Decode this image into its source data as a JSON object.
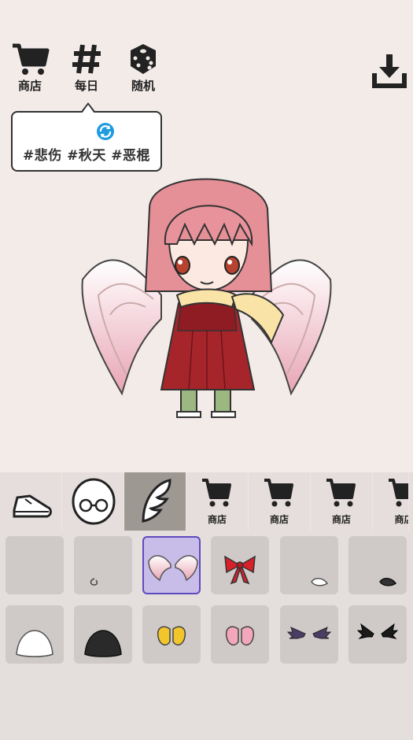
{
  "top_bar": {
    "shop_label": "商店",
    "daily_label": "每日",
    "random_label": "随机"
  },
  "daily_bubble": {
    "tags": "#悲伤 #秋天 #恶棍"
  },
  "category_bar": {
    "categories": [
      {
        "name": "shoes",
        "icon": "shoe-icon"
      },
      {
        "name": "face",
        "icon": "glasses-face-icon"
      },
      {
        "name": "wings",
        "icon": "wing-icon",
        "selected": true
      },
      {
        "name": "shop-1",
        "icon": "cart-icon",
        "label": "商店"
      },
      {
        "name": "shop-2",
        "icon": "cart-icon",
        "label": "商店"
      },
      {
        "name": "shop-3",
        "icon": "cart-icon",
        "label": "商店"
      },
      {
        "name": "shop-4",
        "icon": "cart-icon",
        "label": "商店"
      }
    ]
  },
  "items": [
    {
      "name": "none",
      "icon": "empty"
    },
    {
      "name": "small-curl",
      "icon": "curl-icon"
    },
    {
      "name": "angel-wings",
      "icon": "angel-wings-icon",
      "selected": true
    },
    {
      "name": "red-bow",
      "icon": "red-bow-icon"
    },
    {
      "name": "white-tail",
      "icon": "white-tail-icon"
    },
    {
      "name": "black-tail",
      "icon": "black-tail-icon"
    },
    {
      "name": "white-mound",
      "icon": "white-mound-icon"
    },
    {
      "name": "black-mound",
      "icon": "black-mound-icon"
    },
    {
      "name": "yellow-wings",
      "icon": "yellow-wings-icon"
    },
    {
      "name": "pink-wings",
      "icon": "pink-wings-icon"
    },
    {
      "name": "purple-bat-wings",
      "icon": "purple-bat-wings-icon"
    },
    {
      "name": "black-bat-wings",
      "icon": "black-bat-wings-icon"
    }
  ],
  "colors": {
    "background": "#f3ebe8",
    "selected_border": "#5e4bbd",
    "selected_fill": "#c8bde8",
    "refresh_blue": "#1e9ce0"
  }
}
